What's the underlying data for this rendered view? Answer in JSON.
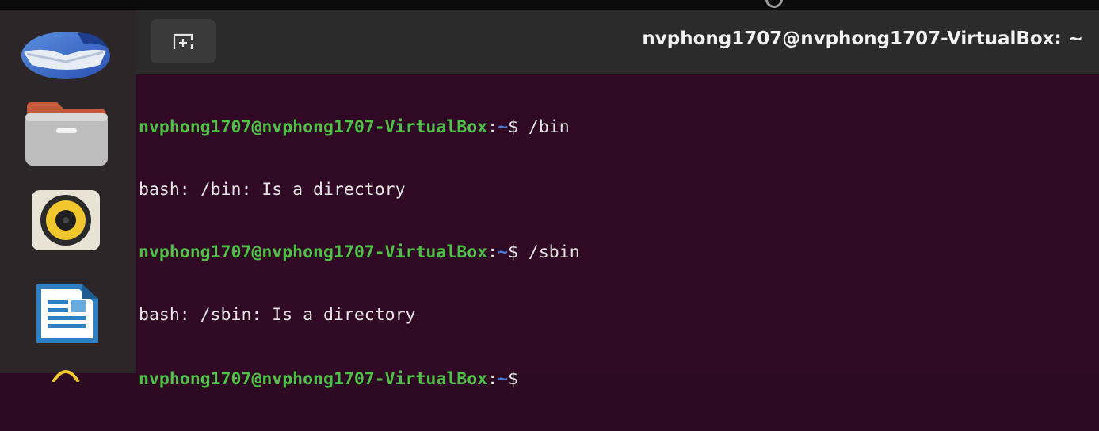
{
  "window": {
    "title": "nvphong1707@nvphong1707-VirtualBox: ~"
  },
  "dock": {
    "items": [
      {
        "name": "thunderbird-icon"
      },
      {
        "name": "files-icon"
      },
      {
        "name": "rhythmbox-icon"
      },
      {
        "name": "libreoffice-writer-icon"
      }
    ]
  },
  "headerbar": {
    "new_tab_icon": "new-tab-icon"
  },
  "terminal": {
    "prompt_user": "nvphong1707@nvphong1707-VirtualBox",
    "prompt_colon": ":",
    "prompt_path": "~",
    "prompt_symbol": "$",
    "lines": [
      {
        "type": "prompt",
        "command": " /bin"
      },
      {
        "type": "output",
        "text": "bash: /bin: Is a directory"
      },
      {
        "type": "prompt",
        "command": " /sbin"
      },
      {
        "type": "output",
        "text": "bash: /sbin: Is a directory"
      },
      {
        "type": "prompt",
        "command": ""
      }
    ]
  },
  "colors": {
    "terminal_bg": "#300a24",
    "prompt_user": "#4ec146",
    "prompt_path": "#4b7bd6",
    "text": "#e6e6e6"
  }
}
